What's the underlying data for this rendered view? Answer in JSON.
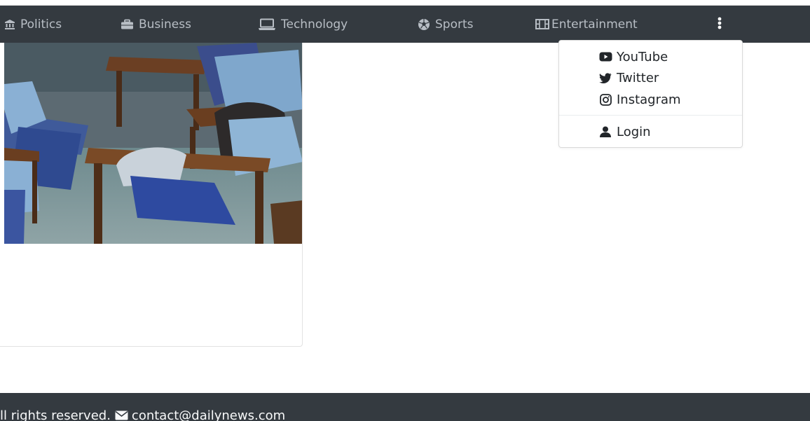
{
  "navbar": {
    "items": [
      {
        "label": "Politics",
        "icon": "landmark-icon"
      },
      {
        "label": "Business",
        "icon": "briefcase-icon"
      },
      {
        "label": "Technology",
        "icon": "laptop-icon"
      },
      {
        "label": "Sports",
        "icon": "futbol-icon"
      },
      {
        "label": "Entertainment",
        "icon": "film-icon"
      }
    ],
    "more_icon": "ellipsis-vertical-icon"
  },
  "dropdown": {
    "items": [
      {
        "label": "YouTube",
        "icon": "youtube-icon"
      },
      {
        "label": "Twitter",
        "icon": "twitter-icon"
      },
      {
        "label": "Instagram",
        "icon": "instagram-icon"
      }
    ],
    "login": {
      "label": "Login",
      "icon": "user-icon"
    }
  },
  "card": {
    "image": "classroom-students-photo"
  },
  "footer": {
    "rights": "ll rights reserved.",
    "email_icon": "envelope-icon",
    "email": "contact@dailynews.com"
  },
  "colors": {
    "navbar_bg": "#343a40",
    "nav_text": "#b8bec5",
    "footer_bg": "#343a40",
    "footer_text": "#f8f9fa",
    "dropdown_text": "#212529"
  }
}
